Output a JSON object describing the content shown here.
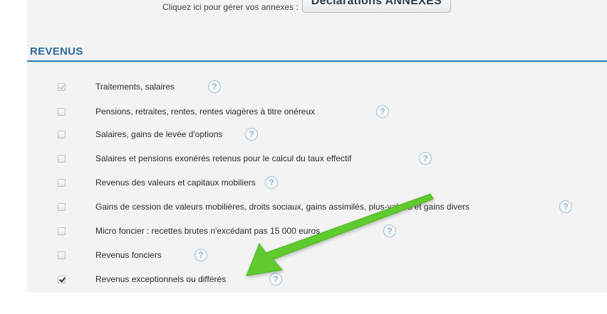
{
  "annexes": {
    "label": "Cliquez ici pour gérer vos annexes :",
    "button_label": "Déclarations ANNEXES"
  },
  "section": {
    "title": "REVENUS"
  },
  "rows": [
    {
      "label": "Traitements, salaires",
      "checked": true,
      "disabled": true
    },
    {
      "label": "Pensions, retraites, rentes, rentes viagères à titre onéreux",
      "checked": false,
      "disabled": false
    },
    {
      "label": "Salaires, gains de levée d'options",
      "checked": false,
      "disabled": false
    },
    {
      "label": "Salaires et pensions exonérés retenus pour le calcul du taux effectif",
      "checked": false,
      "disabled": false
    },
    {
      "label": "Revenus des valeurs et capitaux mobiliers",
      "checked": false,
      "disabled": false
    },
    {
      "label": "Gains de cession de valeurs mobilières, droits sociaux, gains assimilés, plus-values et gains divers",
      "checked": false,
      "disabled": false
    },
    {
      "label": "Micro foncier : recettes brutes n'excédant pas 15 000 euros",
      "checked": false,
      "disabled": false
    },
    {
      "label": "Revenus fonciers",
      "checked": false,
      "disabled": false
    },
    {
      "label": "Revenus exceptionnels ou différés",
      "checked": true,
      "disabled": false
    }
  ],
  "help_glyph": "?",
  "colors": {
    "section_title": "#2b6aa0",
    "section_line": "#2b7bb8",
    "help_icon": "#9ec0db",
    "arrow": "#5ecb2e",
    "panel_bg": "#f3f3f3"
  },
  "icons": {
    "help": "question-circle-icon",
    "arrow": "annotation-arrow-icon"
  }
}
